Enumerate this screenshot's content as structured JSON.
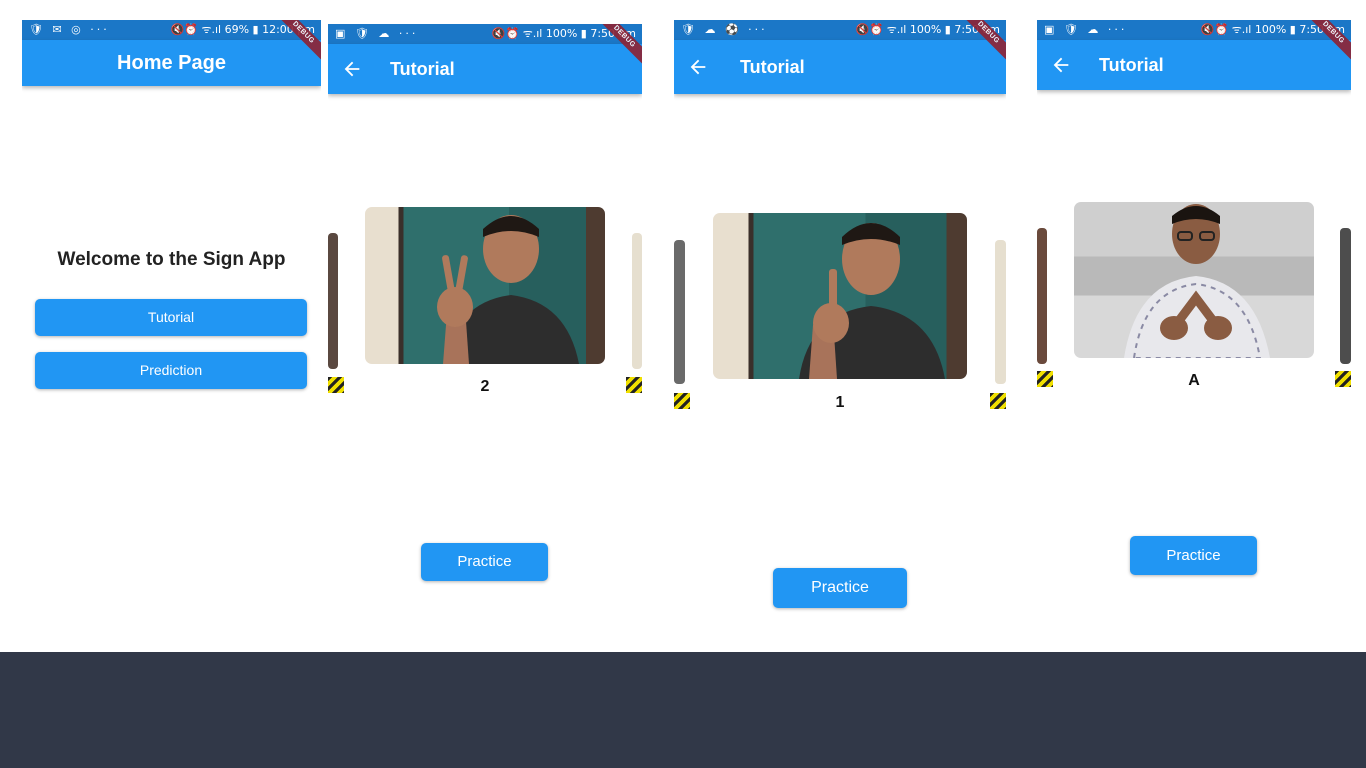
{
  "colors": {
    "primary": "#2196f3",
    "status_bar": "#1b77c7",
    "debug_banner": "#8f2233",
    "bottom_band": "#313848"
  },
  "home": {
    "status_left_icons": "🛡 ✉ ◎ ···",
    "status_right": "🔇⏰ ᯤ.ıl 69% ▮ 12:00 pm",
    "title": "Home Page",
    "welcome": "Welcome to the Sign App",
    "tutorial_button": "Tutorial",
    "prediction_button": "Prediction"
  },
  "screens": [
    {
      "status_left_icons": "▣ 🛡 ☁ ···",
      "status_right": "🔇⏰ ᯤ.ıl 100% ▮ 7:50 am",
      "title": "Tutorial",
      "label": "2",
      "practice": "Practice"
    },
    {
      "status_left_icons": "🛡 ☁ ⚽ ···",
      "status_right": "🔇⏰ ᯤ.ıl 100% ▮ 7:50 am",
      "title": "Tutorial",
      "label": "1",
      "practice": "Practice"
    },
    {
      "status_left_icons": "▣ 🛡 ☁ ···",
      "status_right": "🔇⏰ ᯤ.ıl 100% ▮ 7:50 am",
      "title": "Tutorial",
      "label": "A",
      "practice": "Practice"
    }
  ],
  "debug_label": "DEBUG",
  "icons": {
    "back": "arrow-back-icon",
    "debug": "debug-ribbon"
  }
}
